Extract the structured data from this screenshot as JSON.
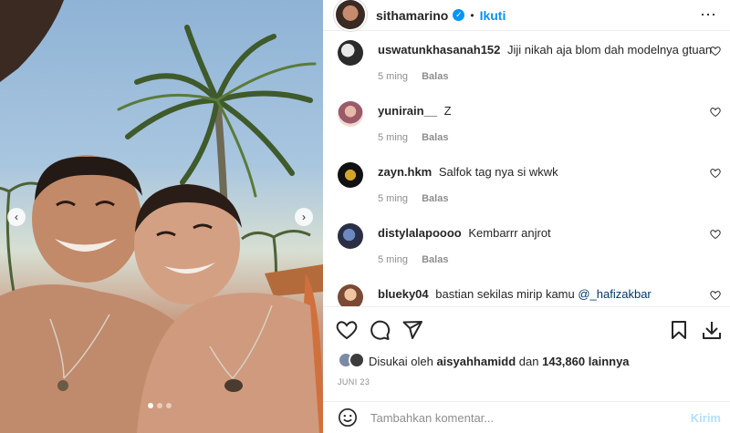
{
  "header": {
    "username": "sithamarino",
    "separator": "•",
    "follow_label": "Ikuti",
    "more_icon": "⋯"
  },
  "carousel": {
    "prev_icon": "‹",
    "next_icon": "›",
    "current_index": 1,
    "total": 3
  },
  "comments": [
    {
      "username": "uswatunkhasanah152",
      "text": "Jiji nikah aja blom dah modelnya gtuan",
      "time": "5 ming",
      "reply": "Balas"
    },
    {
      "username": "yunirain__",
      "text": "Z",
      "time": "5 ming",
      "reply": "Balas"
    },
    {
      "username": "zayn.hkm",
      "text": "Salfok tag nya si wkwk",
      "time": "5 ming",
      "reply": "Balas"
    },
    {
      "username": "distylalapoooo",
      "text": "Kembarrr anjrot",
      "time": "5 ming",
      "reply": "Balas"
    },
    {
      "username": "blueky04",
      "text": "bastian sekilas mirip kamu",
      "mention": "@_hafizakbar"
    }
  ],
  "likes": {
    "prefix": "Disukai oleh",
    "user": "aisyahhamidd",
    "joiner": "dan",
    "count": "143,860",
    "suffix": "lainnya"
  },
  "date": "JUNI 23",
  "add_comment": {
    "placeholder": "Tambahkan komentar...",
    "post_label": "Kirim"
  },
  "colors": {
    "accent": "#0095f6",
    "post_disabled": "#b2dffc",
    "meta": "#8e8e8e"
  }
}
